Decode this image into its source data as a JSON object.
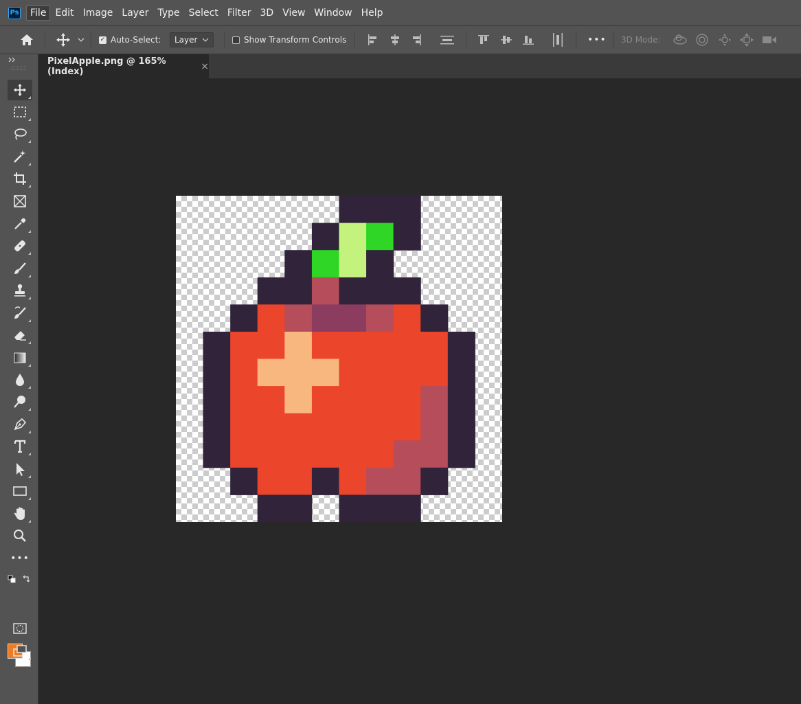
{
  "app": {
    "logo_text": "Ps"
  },
  "menu": [
    "File",
    "Edit",
    "Image",
    "Layer",
    "Type",
    "Select",
    "Filter",
    "3D",
    "View",
    "Window",
    "Help"
  ],
  "options": {
    "auto_select_label": "Auto-Select:",
    "auto_select_checked": true,
    "auto_select_target": "Layer",
    "show_transform_label": "Show Transform Controls",
    "show_transform_checked": false,
    "more_label": "•••",
    "mode_3d_label": "3D Mode:"
  },
  "toolbar": {
    "more_label": "•••"
  },
  "document": {
    "tab_title": "PixelApple.png @ 165% (Index)",
    "close_glyph": "×"
  },
  "colors": {
    "foreground": "#ee7c22",
    "background": "#ffffff"
  },
  "pixel_art": {
    "grid": 12,
    "palette": {
      "D": "#30233a",
      "R": "#eb462c",
      "M": "#b54e5a",
      "P": "#8c3c5e",
      "S": "#f7b77f",
      "G": "#2fd626",
      "L": "#c3f37c"
    },
    "rows": [
      "......DDD...",
      ".....DLGD...",
      "....DGLD....",
      "...DDMDDD...",
      "..DRMPPMRD..",
      ".DRRSRRRRRD.",
      ".DRSSSRRRRD.",
      ".DRRSRRRRMD.",
      ".DRRRRRRRMD.",
      ".DRRRRRRMMD.",
      "..DRRDRMMD..",
      "...DD.DDD..."
    ]
  }
}
